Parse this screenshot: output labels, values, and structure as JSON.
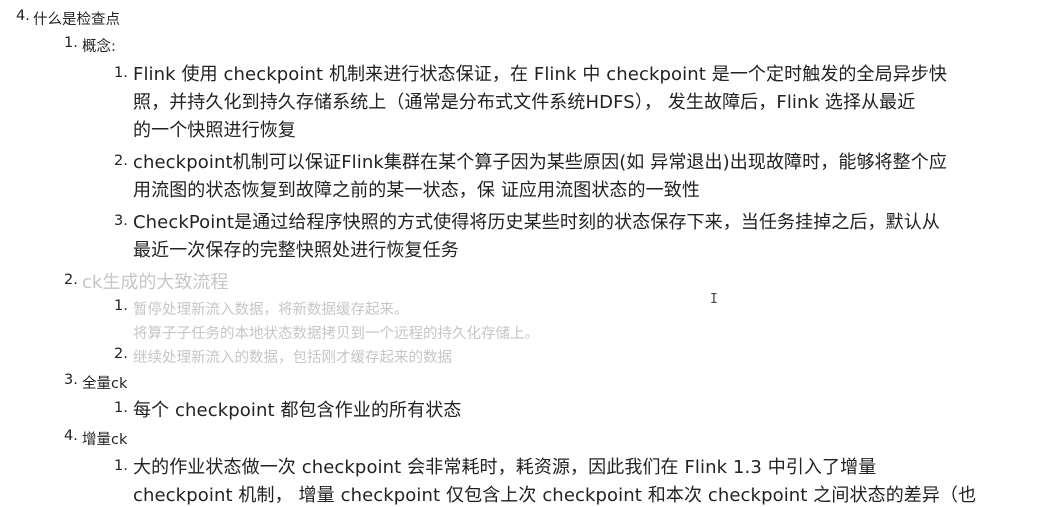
{
  "outline": {
    "top": {
      "number": "4.",
      "title": "什么是检查点"
    },
    "concept": {
      "number": "1.",
      "title": "概念:",
      "items": [
        {
          "number": "1.",
          "lines": [
            "Flink 使用 checkpoint 机制来进行状态保证，在 Flink 中 checkpoint 是一个定时触发的全局异步快",
            "照，并持久化到持久存储系统上（通常是分布式文件系统HDFS）， 发生故障后，Flink 选择从最近",
            "的一个快照进行恢复"
          ]
        },
        {
          "number": "2.",
          "lines": [
            "checkpoint机制可以保证Flink集群在某个算子因为某些原因(如 异常退出)出现故障时，能够将整个应",
            "用流图的状态恢复到故障之前的某一状态，保 证应用流图状态的一致性"
          ]
        },
        {
          "number": "3.",
          "lines": [
            "CheckPoint是通过给程序快照的方式使得将历史某些时刻的状态保存下来，当任务挂掉之后，默认从",
            "最近一次保存的完整快照处进行恢复任务"
          ]
        }
      ]
    },
    "ck_flow": {
      "number": "2.",
      "title": "ck生成的大致流程",
      "items": [
        {
          "number": "1.",
          "lines": [
            "暂停处理新流入数据，将新数据缓存起来。",
            "将算子子任务的本地状态数据拷贝到一个远程的持久化存储上。"
          ]
        },
        {
          "number": "2.",
          "lines": [
            "继续处理新流入的数据，包括刚才缓存起来的数据"
          ]
        }
      ]
    },
    "full_ck": {
      "number": "3.",
      "title": "全量ck",
      "items": [
        {
          "number": "1.",
          "lines": [
            "每个 checkpoint 都包含作业的所有状态"
          ]
        }
      ]
    },
    "incr_ck": {
      "number": "4.",
      "title": "增量ck",
      "items": [
        {
          "number": "1.",
          "lines": [
            "大的作业状态做一次 checkpoint 会非常耗时，耗资源，因此我们在 Flink 1.3 中引入了增量",
            "checkpoint 机制， 增量 checkpoint 仅包含上次 checkpoint 和本次 checkpoint 之间状态的差异（也"
          ]
        }
      ]
    }
  }
}
